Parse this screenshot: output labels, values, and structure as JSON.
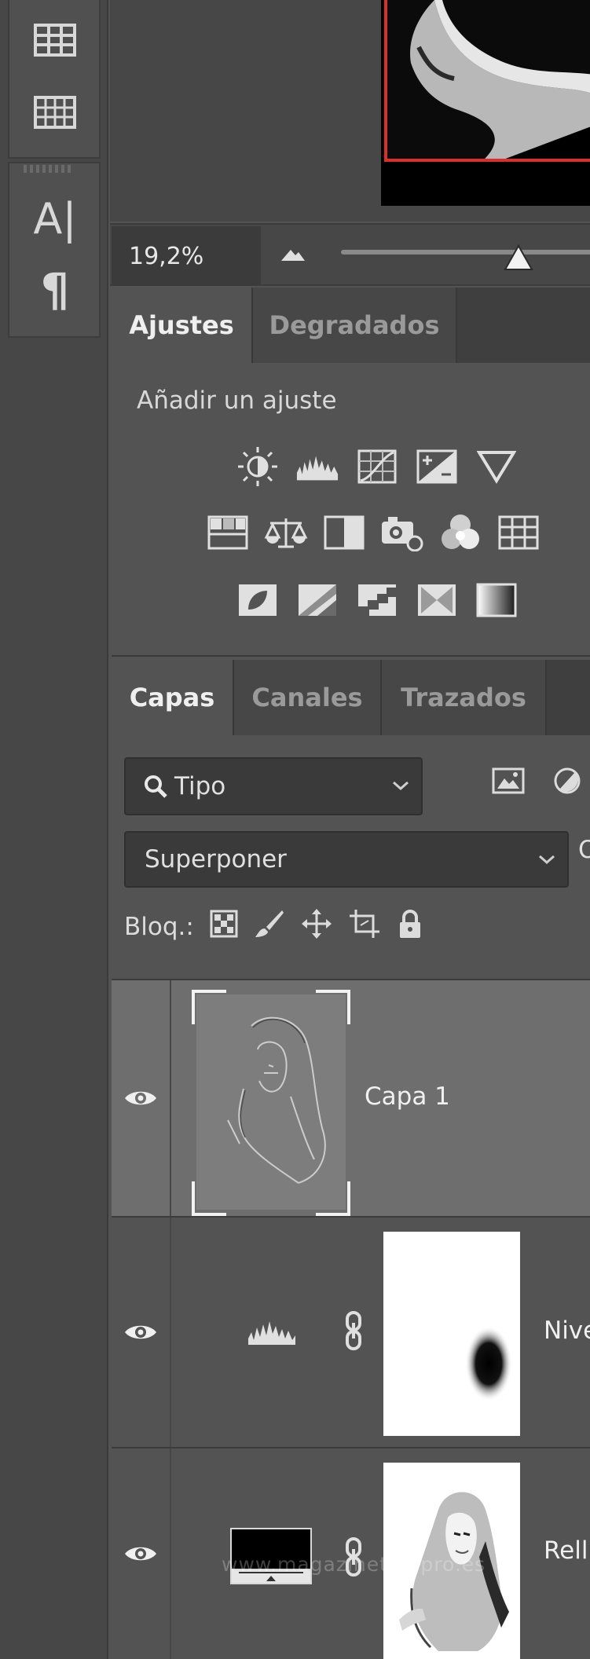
{
  "zoom": {
    "value": "19,2%"
  },
  "adjustments_panel": {
    "tabs": [
      {
        "label": "Ajustes",
        "active": true
      },
      {
        "label": "Degradados",
        "active": false
      }
    ],
    "title": "Añadir un ajuste",
    "rows": [
      [
        "brightness-contrast-icon",
        "levels-icon",
        "curves-icon",
        "exposure-icon",
        "vibrance-icon"
      ],
      [
        "hue-saturation-icon",
        "color-balance-icon",
        "black-white-icon",
        "photo-filter-icon",
        "channel-mixer-icon",
        "color-lookup-icon"
      ],
      [
        "invert-icon",
        "posterize-icon",
        "threshold-icon",
        "selective-color-icon",
        "gradient-map-icon"
      ]
    ]
  },
  "layers_panel": {
    "tabs": [
      {
        "label": "Capas",
        "active": true
      },
      {
        "label": "Canales",
        "active": false
      },
      {
        "label": "Trazados",
        "active": false
      }
    ],
    "filter": {
      "value": "Tipo"
    },
    "blend_mode": {
      "value": "Superponer"
    },
    "opacity_label_cut": "O",
    "lock_label": "Bloq.:",
    "layers": [
      {
        "name": "Capa 1",
        "visible": true,
        "selected": true
      },
      {
        "name": "Nive",
        "visible": true,
        "selected": false,
        "type": "levels-adjustment"
      },
      {
        "name": "Rell",
        "visible": true,
        "selected": false,
        "type": "fill-layer"
      }
    ]
  },
  "watermark": "www.magazinetfcdpro.es",
  "colors": {
    "panel_bg": "#535353",
    "toolbar_bg": "#474747",
    "selected_layer": "#6e6e6e",
    "canvas_border": "#d9302b"
  }
}
